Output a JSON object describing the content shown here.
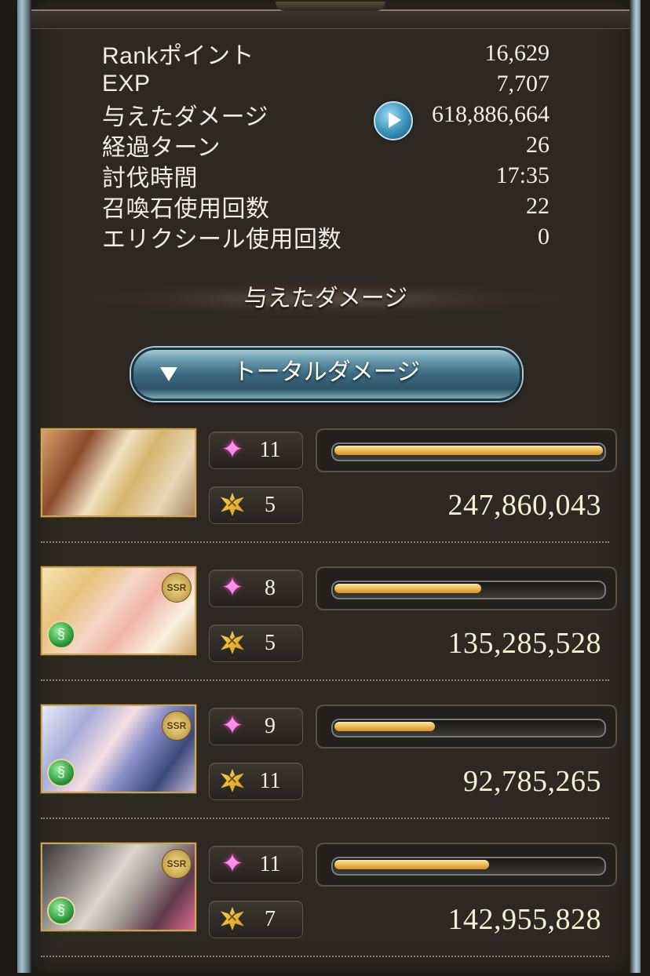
{
  "stats": [
    {
      "label": "Rankポイント",
      "value": "16,629"
    },
    {
      "label": "EXP",
      "value": "7,707"
    },
    {
      "label": "与えたダメージ",
      "value": "618,886,664"
    },
    {
      "label": "経過ターン",
      "value": "26"
    },
    {
      "label": "討伐時間",
      "value": "17:35"
    },
    {
      "label": "召喚石使用回数",
      "value": "22"
    },
    {
      "label": "エリクシール使用回数",
      "value": "0"
    }
  ],
  "section_title": "与えたダメージ",
  "dropdown": {
    "label": "トータルダメージ"
  },
  "characters": [
    {
      "star_count": "11",
      "ca_count": "5",
      "damage": "247,860,043",
      "damage_ratio": 1.0,
      "ssr": false,
      "element": false
    },
    {
      "star_count": "8",
      "ca_count": "5",
      "damage": "135,285,528",
      "damage_ratio": 0.546,
      "ssr": true,
      "ssr_text": "SSR",
      "element": true
    },
    {
      "star_count": "9",
      "ca_count": "11",
      "damage": "92,785,265",
      "damage_ratio": 0.374,
      "ssr": true,
      "ssr_text": "SSR",
      "element": true
    },
    {
      "star_count": "11",
      "ca_count": "7",
      "damage": "142,955,828",
      "damage_ratio": 0.577,
      "ssr": true,
      "ssr_text": "SSR",
      "element": true
    }
  ],
  "icons": {
    "play": "play-icon",
    "dropdown": "triangle-down-icon",
    "star": "sparkle-star-icon",
    "ca": "charge-attack-icon",
    "element": "wind-element-icon"
  }
}
